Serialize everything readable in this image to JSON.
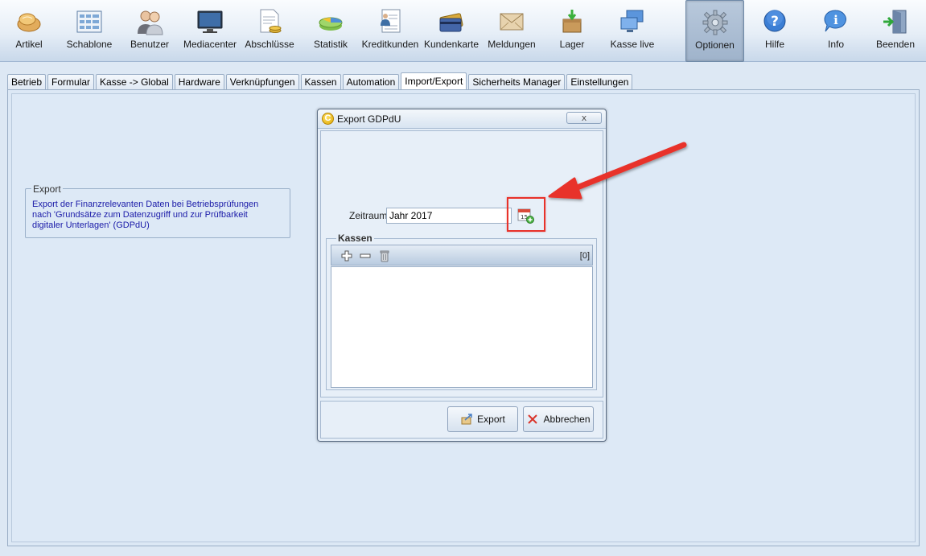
{
  "toolbar": {
    "items": [
      {
        "label": "Artikel",
        "icon": "bread-icon"
      },
      {
        "label": "Schablone",
        "icon": "keypad-icon"
      },
      {
        "label": "Benutzer",
        "icon": "users-icon"
      },
      {
        "label": "Mediacenter",
        "icon": "monitor-icon"
      },
      {
        "label": "Abschlüsse",
        "icon": "document-coins-icon"
      },
      {
        "label": "Statistik",
        "icon": "chart-icon"
      },
      {
        "label": "Kreditkunden",
        "icon": "customer-card-icon"
      },
      {
        "label": "Kundenkarte",
        "icon": "cards-icon"
      },
      {
        "label": "Meldungen",
        "icon": "envelope-icon"
      },
      {
        "label": "Lager",
        "icon": "boxes-icon"
      },
      {
        "label": "Kasse live",
        "icon": "screens-icon"
      },
      {
        "label": "Optionen",
        "icon": "gear-icon"
      },
      {
        "label": "Hilfe",
        "icon": "help-icon"
      },
      {
        "label": "Info",
        "icon": "info-icon"
      },
      {
        "label": "Beenden",
        "icon": "exit-door-icon"
      }
    ],
    "active": "Optionen"
  },
  "tabs": {
    "items": [
      "Betrieb",
      "Formular",
      "Kasse -> Global",
      "Hardware",
      "Verknüpfungen",
      "Kassen",
      "Automation",
      "Import/Export",
      "Sicherheits Manager",
      "Einstellungen"
    ],
    "active": "Import/Export"
  },
  "export_box": {
    "legend": "Export",
    "description": "Export der Finanzrelevanten Daten bei Betriebsprüfungen nach 'Grundsätze zum Datenzugriff und zur Prüfbarkeit digitaler Unterlagen' (GDPdU)"
  },
  "dialog": {
    "title": "Export GDPdU",
    "logo_letter": "C",
    "close_label": "x",
    "zeitraum_label": "Zeitraum",
    "zeitraum_value": "Jahr 2017",
    "calendar_day": "15",
    "kassen_legend": "Kassen",
    "kassen_count": "[0]",
    "export_label": "Export",
    "cancel_label": "Abbrechen"
  },
  "colors": {
    "highlight": "#e8322a",
    "link_text": "#1a1aa8",
    "active_tab_bg": "#ffffff"
  }
}
